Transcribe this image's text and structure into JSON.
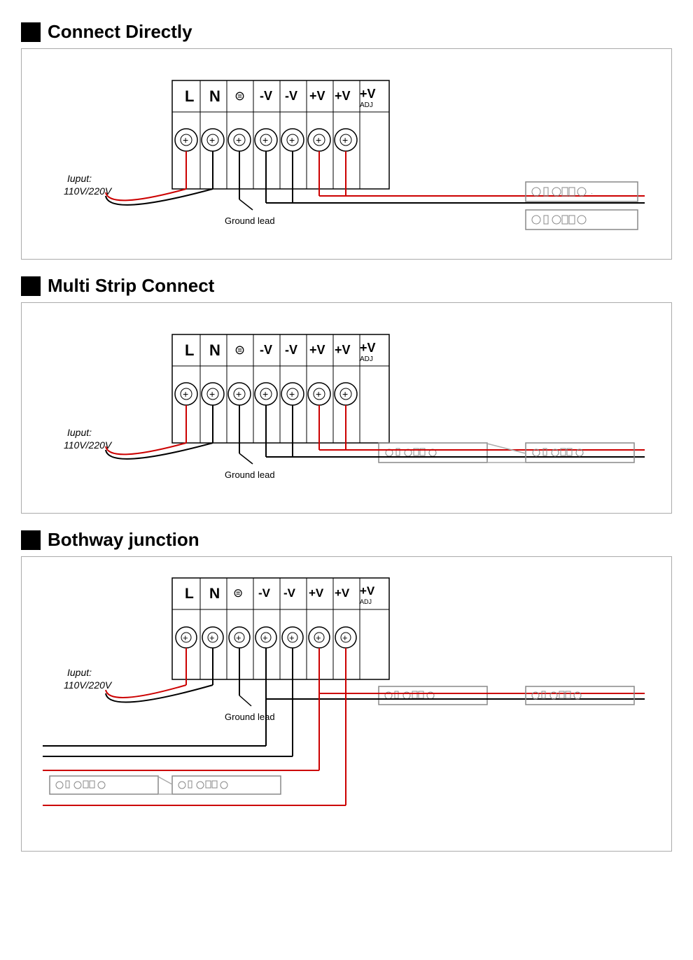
{
  "sections": [
    {
      "id": "connect-directly",
      "title": "Connect Directly",
      "groundLabel": "Ground lead",
      "inputLabel": "Iuput:\n110V/220V"
    },
    {
      "id": "multi-strip",
      "title": "Multi Strip Connect",
      "groundLabel": "Ground lead",
      "inputLabel": "Iuput:\n110V/220V"
    },
    {
      "id": "bothway-junction",
      "title": "Bothway junction",
      "groundLabel": "Ground lead",
      "inputLabel": "Iuput:\n110V/220V"
    }
  ]
}
